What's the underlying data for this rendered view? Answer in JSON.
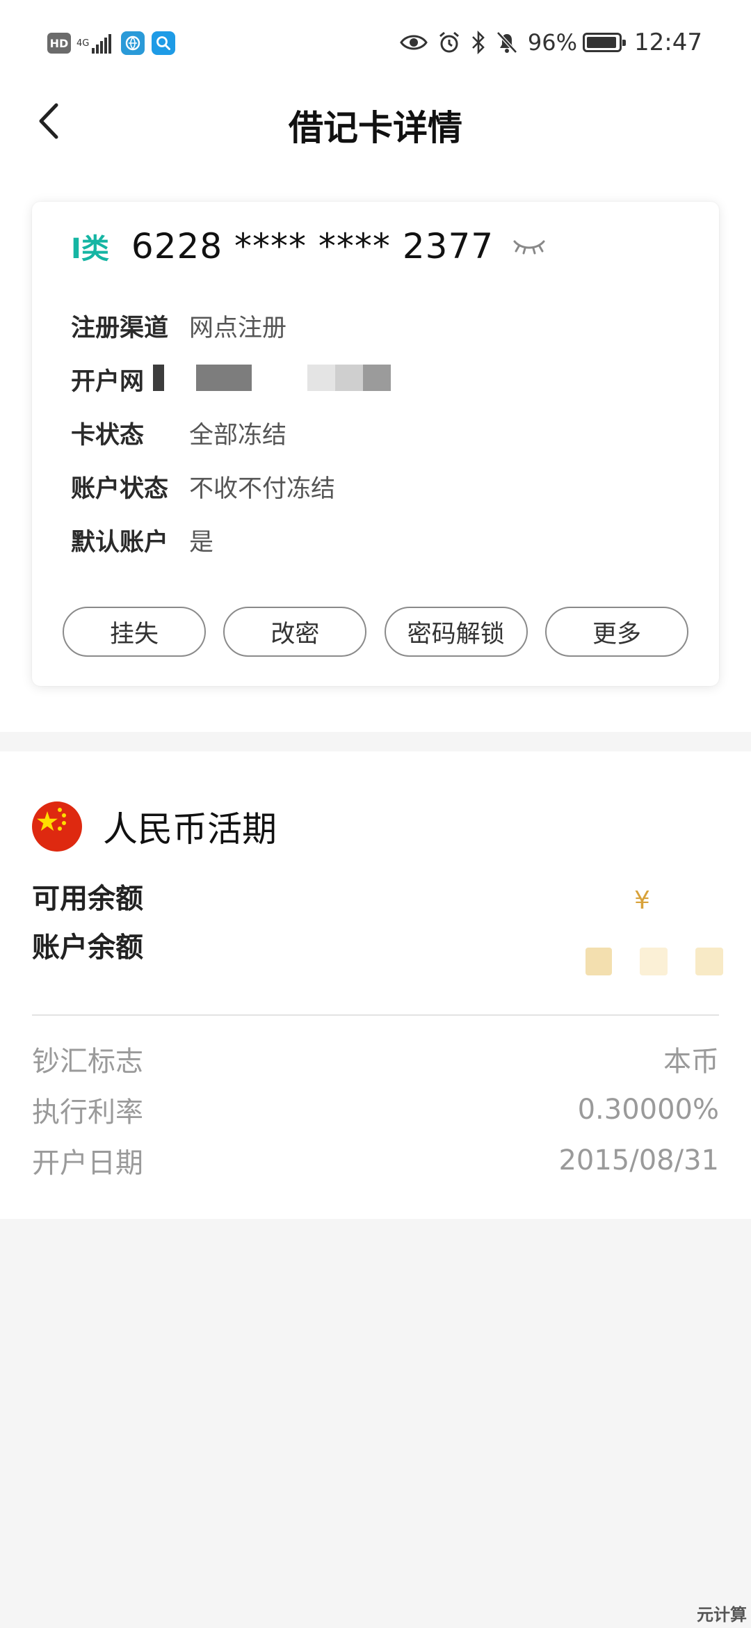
{
  "status_bar": {
    "hd": "HD",
    "net_type": "4G",
    "battery_percent": "96%",
    "time": "12:47",
    "icons": [
      "eye-icon",
      "alarm-icon",
      "bluetooth-icon",
      "bell-off-icon",
      "battery-icon"
    ]
  },
  "header": {
    "title": "借记卡详情"
  },
  "card": {
    "class_badge": "I类",
    "card_number": "6228 **** **** 2377",
    "rows": [
      {
        "label": "注册渠道",
        "value": "网点注册"
      },
      {
        "label": "开户网",
        "value": ""
      },
      {
        "label": "卡状态",
        "value": "全部冻结"
      },
      {
        "label": "账户状态",
        "value": "不收不付冻结"
      },
      {
        "label": "默认账户",
        "value": "是"
      }
    ],
    "buttons": [
      "挂失",
      "改密",
      "密码解锁",
      "更多"
    ]
  },
  "account": {
    "title": "人民币活期",
    "available_label": "可用余额",
    "balance_label": "账户余额",
    "currency_symbol": "¥",
    "meta": [
      {
        "label": "钞汇标志",
        "value": "本币"
      },
      {
        "label": "执行利率",
        "value": "0.30000%"
      },
      {
        "label": "开户日期",
        "value": "2015/08/31"
      }
    ]
  },
  "watermark": "元计算",
  "colors": {
    "accent": "#15b5a3",
    "gold": "#d8a23a",
    "background": "#f5f5f5"
  }
}
